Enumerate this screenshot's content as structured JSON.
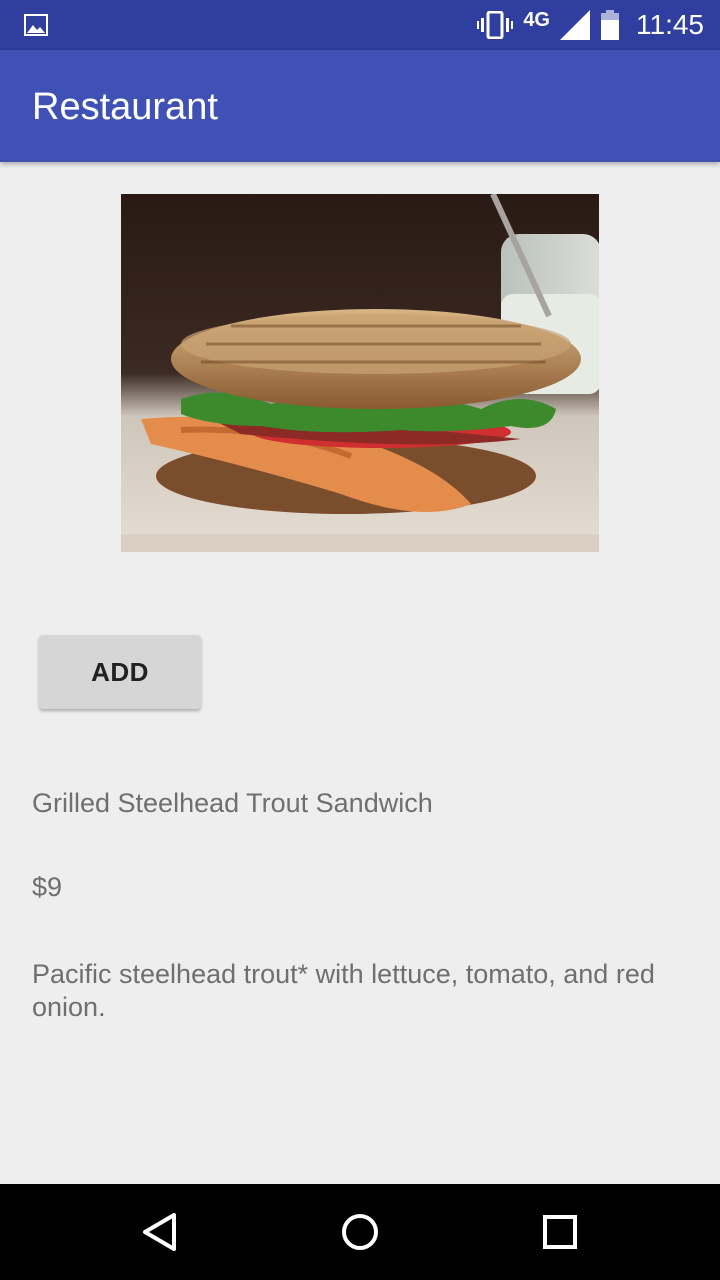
{
  "status_bar": {
    "network": "4G",
    "time": "11:45",
    "icons": [
      "image-icon",
      "vibrate-icon",
      "signal-icon",
      "battery-icon"
    ]
  },
  "app_bar": {
    "title": "Restaurant"
  },
  "item": {
    "add_label": "ADD",
    "name": "Grilled Steelhead Trout Sandwich",
    "price": "$9",
    "description": "Pacific steelhead trout* with lettuce, tomato, and red onion."
  },
  "nav_bar": {
    "icons": [
      "back-icon",
      "home-icon",
      "recents-icon"
    ]
  },
  "colors": {
    "status_bar": "#303f9f",
    "app_bar": "#3f51b5",
    "background": "#eeeeee",
    "button": "#d6d6d6"
  }
}
